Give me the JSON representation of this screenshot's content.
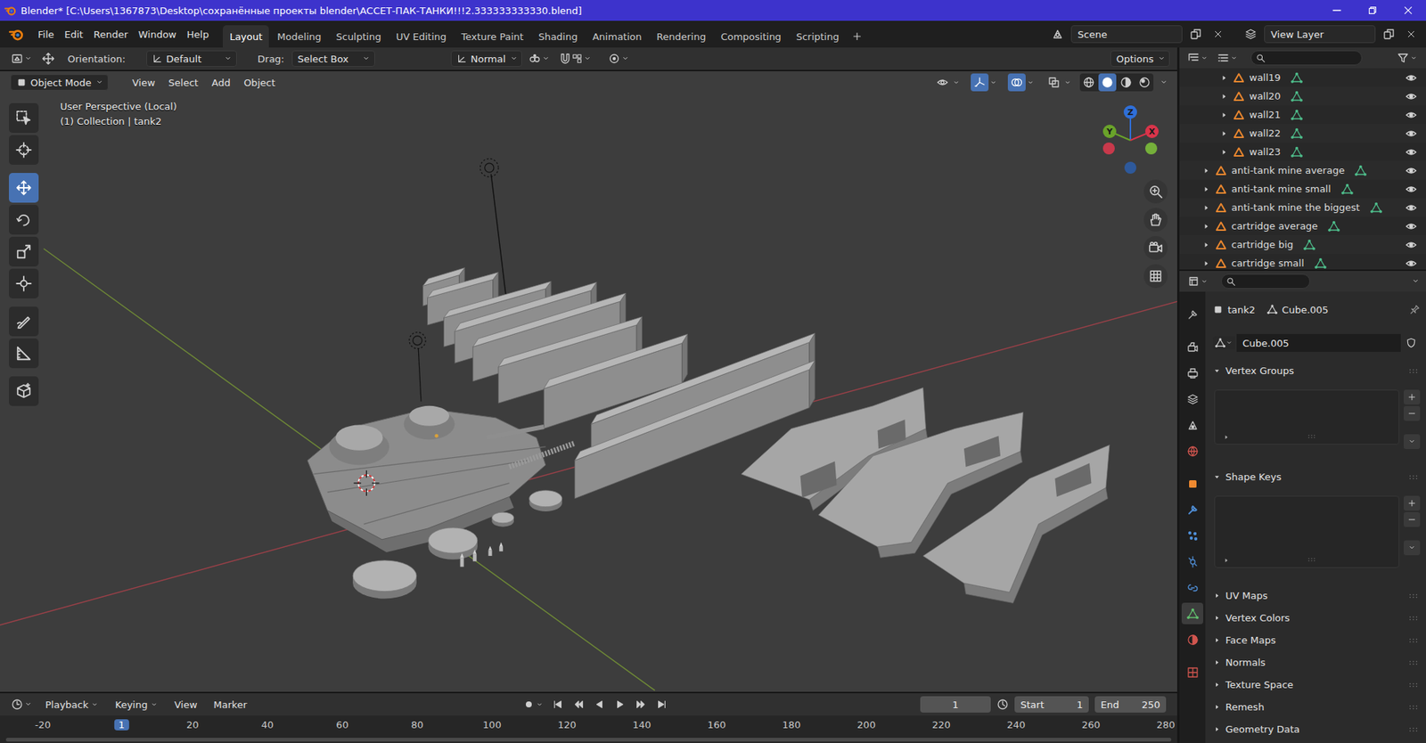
{
  "window": {
    "title": "Blender* [C:\\Users\\1367873\\Desktop\\сохранённые проекты blender\\АССЕТ-ПАК-ТАНКИ!!!2.333333333330.blend]"
  },
  "menu": [
    "File",
    "Edit",
    "Render",
    "Window",
    "Help"
  ],
  "workspaces": [
    {
      "label": "Layout",
      "selected": true
    },
    {
      "label": "Modeling",
      "selected": false
    },
    {
      "label": "Sculpting",
      "selected": false
    },
    {
      "label": "UV Editing",
      "selected": false
    },
    {
      "label": "Texture Paint",
      "selected": false
    },
    {
      "label": "Shading",
      "selected": false
    },
    {
      "label": "Animation",
      "selected": false
    },
    {
      "label": "Rendering",
      "selected": false
    },
    {
      "label": "Compositing",
      "selected": false
    },
    {
      "label": "Scripting",
      "selected": false
    }
  ],
  "scene": "Scene",
  "view_layer": "View Layer",
  "tool_header": {
    "orientation_label": "Orientation:",
    "orientation": "Default",
    "drag_label": "Drag:",
    "drag": "Select Box",
    "pivot": "Normal",
    "options": "Options"
  },
  "viewport_header": {
    "mode": "Object Mode",
    "menus": [
      "View",
      "Select",
      "Add",
      "Object"
    ],
    "toggles": [
      {
        "kind": "visibility",
        "on": false
      },
      {
        "kind": "gizmo",
        "on": true
      },
      {
        "kind": "overlay",
        "on": true
      },
      {
        "kind": "xray",
        "on": false
      }
    ],
    "shading": [
      {
        "kind": "wireframe",
        "selected": false
      },
      {
        "kind": "solid",
        "selected": true
      },
      {
        "kind": "material",
        "selected": false
      },
      {
        "kind": "rendered",
        "selected": false
      }
    ]
  },
  "viewport": {
    "perspective": "User Perspective (Local)",
    "context": "(1) Collection | tank2",
    "axes": [
      {
        "label": "Z",
        "color": "#2f6fd8"
      },
      {
        "label": "Y",
        "color": "#6aa32a"
      },
      {
        "label": "X",
        "color": "#d9344a"
      }
    ],
    "axis_ends": [
      {
        "color": "#e0384e"
      },
      {
        "color": "#7fc43a"
      },
      {
        "color": "#2b5eab"
      }
    ]
  },
  "tools": [
    {
      "selected": false
    },
    {
      "selected": false
    },
    {
      "selected": true
    },
    {
      "selected": false
    },
    {
      "selected": false
    },
    {
      "selected": false
    },
    {
      "selected": false
    },
    {
      "selected": false
    },
    {
      "selected": false
    }
  ],
  "outliner": {
    "rows": [
      {
        "name": "wall19",
        "depth": 1,
        "expanded": false,
        "visible": true
      },
      {
        "name": "wall20",
        "depth": 1,
        "expanded": false,
        "visible": true
      },
      {
        "name": "wall21",
        "depth": 1,
        "expanded": false,
        "visible": true
      },
      {
        "name": "wall22",
        "depth": 1,
        "expanded": false,
        "visible": true
      },
      {
        "name": "wall23",
        "depth": 1,
        "expanded": false,
        "visible": true
      },
      {
        "name": "anti-tank mine average",
        "depth": 0,
        "expanded": false,
        "visible": true
      },
      {
        "name": "anti-tank mine small",
        "depth": 0,
        "expanded": false,
        "visible": true
      },
      {
        "name": "anti-tank mine the biggest",
        "depth": 0,
        "expanded": false,
        "visible": true
      },
      {
        "name": "cartridge average",
        "depth": 0,
        "expanded": false,
        "visible": true
      },
      {
        "name": "cartridge big",
        "depth": 0,
        "expanded": false,
        "visible": true
      },
      {
        "name": "cartridge small",
        "depth": 0,
        "expanded": false,
        "visible": true
      }
    ]
  },
  "properties": {
    "object": "tank2",
    "mesh": "Cube.005",
    "mesh_field": "Cube.005",
    "tabs": [
      {
        "selected": false
      },
      {
        "selected": false
      },
      {
        "selected": false
      },
      {
        "selected": false
      },
      {
        "selected": false
      },
      {
        "selected": false
      },
      {
        "selected": false
      },
      {
        "selected": false
      },
      {
        "selected": false
      },
      {
        "selected": false
      },
      {
        "selected": false
      },
      {
        "selected": true
      },
      {
        "selected": false
      },
      {
        "selected": false
      }
    ],
    "panels": [
      {
        "label": "Vertex Groups",
        "expanded": true
      },
      {
        "label": "Shape Keys",
        "expanded": true
      },
      {
        "label": "UV Maps",
        "expanded": false
      },
      {
        "label": "Vertex Colors",
        "expanded": false
      },
      {
        "label": "Face Maps",
        "expanded": false
      },
      {
        "label": "Normals",
        "expanded": false
      },
      {
        "label": "Texture Space",
        "expanded": false
      },
      {
        "label": "Remesh",
        "expanded": false
      },
      {
        "label": "Geometry Data",
        "expanded": false
      }
    ]
  },
  "timeline": {
    "menus": [
      "Playback",
      "Keying",
      "View",
      "Marker"
    ],
    "frame": "1",
    "start_label": "Start",
    "start": "1",
    "end_label": "End",
    "end": "250",
    "ruler": [
      {
        "label": "-20",
        "selected": false
      },
      {
        "label": "1",
        "selected": true
      },
      {
        "label": "20",
        "selected": false
      },
      {
        "label": "40",
        "selected": false
      },
      {
        "label": "60",
        "selected": false
      },
      {
        "label": "80",
        "selected": false
      },
      {
        "label": "100",
        "selected": false
      },
      {
        "label": "120",
        "selected": false
      },
      {
        "label": "140",
        "selected": false
      },
      {
        "label": "160",
        "selected": false
      },
      {
        "label": "180",
        "selected": false
      },
      {
        "label": "200",
        "selected": false
      },
      {
        "label": "220",
        "selected": false
      },
      {
        "label": "240",
        "selected": false
      },
      {
        "label": "260",
        "selected": false
      },
      {
        "label": "280",
        "selected": false
      }
    ]
  }
}
